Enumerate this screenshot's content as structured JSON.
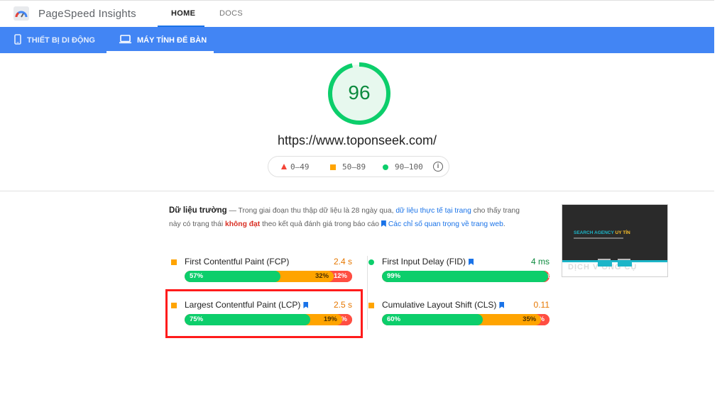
{
  "header": {
    "app_title": "PageSpeed Insights",
    "nav": [
      {
        "label": "HOME",
        "active": true
      },
      {
        "label": "DOCS",
        "active": false
      }
    ]
  },
  "tabs": [
    {
      "label": "THIẾT BỊ DI ĐỘNG",
      "icon": "mobile-icon",
      "active": false
    },
    {
      "label": "MÁY TÍNH ĐỂ BÀN",
      "icon": "desktop-icon",
      "active": true
    }
  ],
  "score": {
    "value": "96",
    "percent": 96,
    "color": "#0cce6b"
  },
  "url": "https://www.toponseek.com/",
  "legend": [
    {
      "label": "0–49",
      "icon": "triangle",
      "color": "#f44336"
    },
    {
      "label": "50–89",
      "icon": "square",
      "color": "#ffa400"
    },
    {
      "label": "90–100",
      "icon": "circle",
      "color": "#0cce6b"
    }
  ],
  "field_data": {
    "title": "Dữ liệu trường",
    "dash": " — ",
    "text1": "Trong giai đoạn thu thập dữ liệu là 28 ngày qua, ",
    "link1": "dữ liệu thực tế tại trang",
    "text2": " cho thấy trang này có trạng thái ",
    "status": "không đạt",
    "text3": " theo kết quả đánh giá trong báo cáo ",
    "link2": "Các chỉ số quan trọng về trang web",
    "text4": "."
  },
  "thumbnail": {
    "headline_a": "SEARCH AGENCY ",
    "headline_b": "UY TÍN",
    "fade_text": "DỊCH V          ỔNG CỤ"
  },
  "metrics": [
    {
      "name": "First Contentful Paint (FCP)",
      "value": "2.4 s",
      "indicator": "square",
      "value_color": "orange",
      "bookmark": false,
      "good": 57,
      "avg": 32,
      "poor": 12,
      "good_label": "57%",
      "avg_label": "32%",
      "poor_label": "12%"
    },
    {
      "name": "First Input Delay (FID)",
      "value": "4 ms",
      "indicator": "circle",
      "value_color": "green",
      "bookmark": true,
      "good": 99,
      "avg": 0,
      "poor": 1,
      "good_label": "99%",
      "avg_label": "",
      "poor_label": "1%"
    },
    {
      "name": "Largest Contentful Paint (LCP)",
      "value": "2.5 s",
      "indicator": "square",
      "value_color": "orange",
      "bookmark": true,
      "good": 75,
      "avg": 19,
      "poor": 6,
      "good_label": "75%",
      "avg_label": "19%",
      "poor_label": "6%"
    },
    {
      "name": "Cumulative Layout Shift (CLS)",
      "value": "0.11",
      "indicator": "square",
      "value_color": "orange",
      "bookmark": true,
      "good": 60,
      "avg": 35,
      "poor": 5,
      "good_label": "60%",
      "avg_label": "35%",
      "poor_label": "5%"
    }
  ]
}
